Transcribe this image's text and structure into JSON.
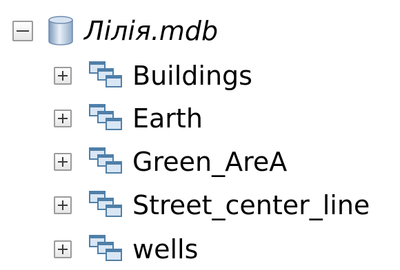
{
  "tree": {
    "root": {
      "label": "Лілія.mdb",
      "icon": "personal-geodatabase-icon",
      "expanded": true
    },
    "children": [
      {
        "label": "Buildings",
        "icon": "feature-dataset-icon",
        "expanded": false
      },
      {
        "label": "Earth",
        "icon": "feature-dataset-icon",
        "expanded": false
      },
      {
        "label": "Green_AreA",
        "icon": "feature-dataset-icon",
        "expanded": false
      },
      {
        "label": "Street_center_line",
        "icon": "feature-dataset-icon",
        "expanded": false
      },
      {
        "label": "wells",
        "icon": "feature-dataset-icon",
        "expanded": false
      }
    ]
  },
  "colors": {
    "toggle_border": "#9b9b9b",
    "toggle_glyph": "#3c3c3c",
    "db_icon": "#8faac8",
    "dataset_frame": "#4f7fa8",
    "dataset_fill": "#d9e6f4",
    "text": "#000000"
  }
}
